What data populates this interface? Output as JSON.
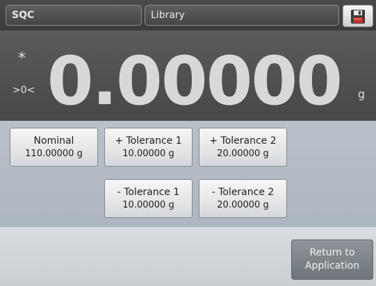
{
  "header": {
    "app_tab": "SQC",
    "library_tab": "Library",
    "save_icon": "floppy-disk-icon"
  },
  "display": {
    "stable_indicator": "*",
    "zero_indicator": ">0<",
    "weight": "0.00000",
    "unit": "g"
  },
  "buttons": {
    "nominal": {
      "label": "Nominal",
      "value": "110.00000 g"
    },
    "plus_tol_1": {
      "label": "+ Tolerance 1",
      "value": "10.00000 g"
    },
    "plus_tol_2": {
      "label": "+ Tolerance 2",
      "value": "20.00000 g"
    },
    "minus_tol_1": {
      "label": "- Tolerance 1",
      "value": "10.00000 g"
    },
    "minus_tol_2": {
      "label": "- Tolerance 2",
      "value": "20.00000 g"
    }
  },
  "footer": {
    "return_line1": "Return to",
    "return_line2": "Application"
  }
}
